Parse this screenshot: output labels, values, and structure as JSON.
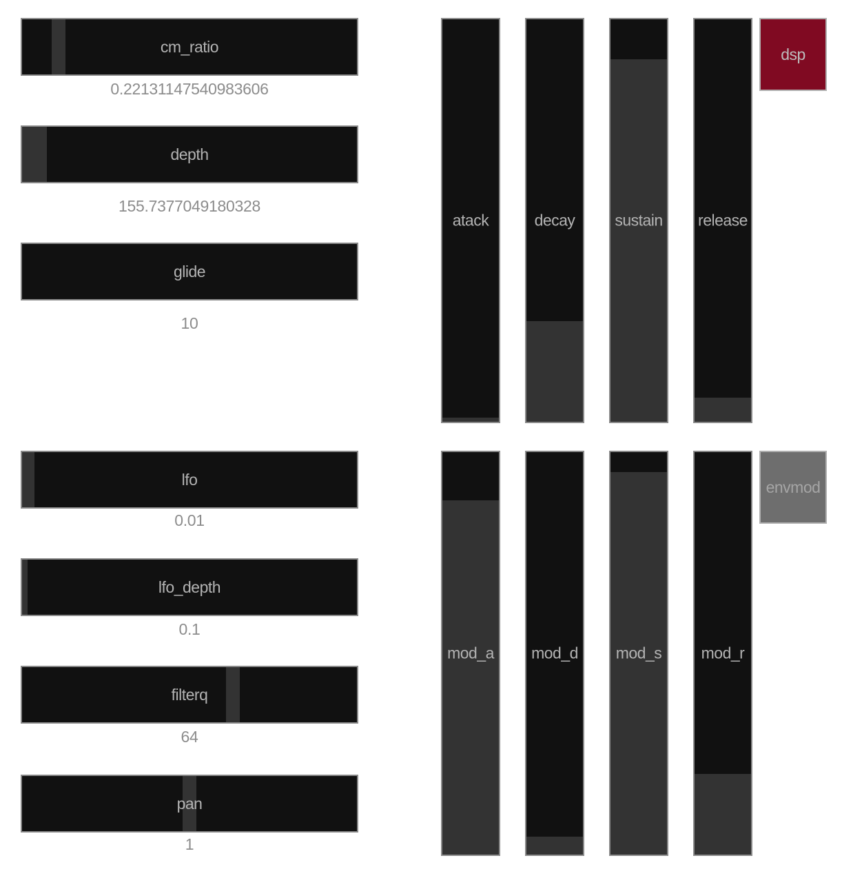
{
  "hsliders": [
    {
      "label": "cm_ratio",
      "value": "0.22131147540983606",
      "level": 0.11
    },
    {
      "label": "depth",
      "value": "155.7377049180328",
      "level": 0.04
    },
    {
      "label": "glide",
      "value": "10",
      "level": 0.0
    },
    {
      "label": "lfo",
      "value": "0.01",
      "level": 0.02
    },
    {
      "label": "lfo_depth",
      "value": "0.1",
      "level": 0.0
    },
    {
      "label": "filterq",
      "value": "64",
      "level": 0.63
    },
    {
      "label": "pan",
      "value": "1",
      "level": 0.5
    }
  ],
  "vsliders": [
    {
      "label": "atack",
      "level": 0.01
    },
    {
      "label": "decay",
      "level": 0.25
    },
    {
      "label": "sustain",
      "level": 0.9
    },
    {
      "label": "release",
      "level": 0.06
    },
    {
      "label": "mod_a",
      "level": 0.88
    },
    {
      "label": "mod_d",
      "level": 0.045
    },
    {
      "label": "mod_s",
      "level": 0.95
    },
    {
      "label": "mod_r",
      "level": 0.2
    }
  ],
  "toggles": {
    "dsp": {
      "label": "dsp",
      "active": true,
      "color": "#800a22"
    },
    "envmod": {
      "label": "envmod",
      "active": false,
      "color": "#6e6e6e"
    }
  },
  "colors": {
    "slider_bg": "#111111",
    "slider_fill": "#333333",
    "label_text": "#b3b3b3",
    "value_text": "#8c8c8c"
  }
}
